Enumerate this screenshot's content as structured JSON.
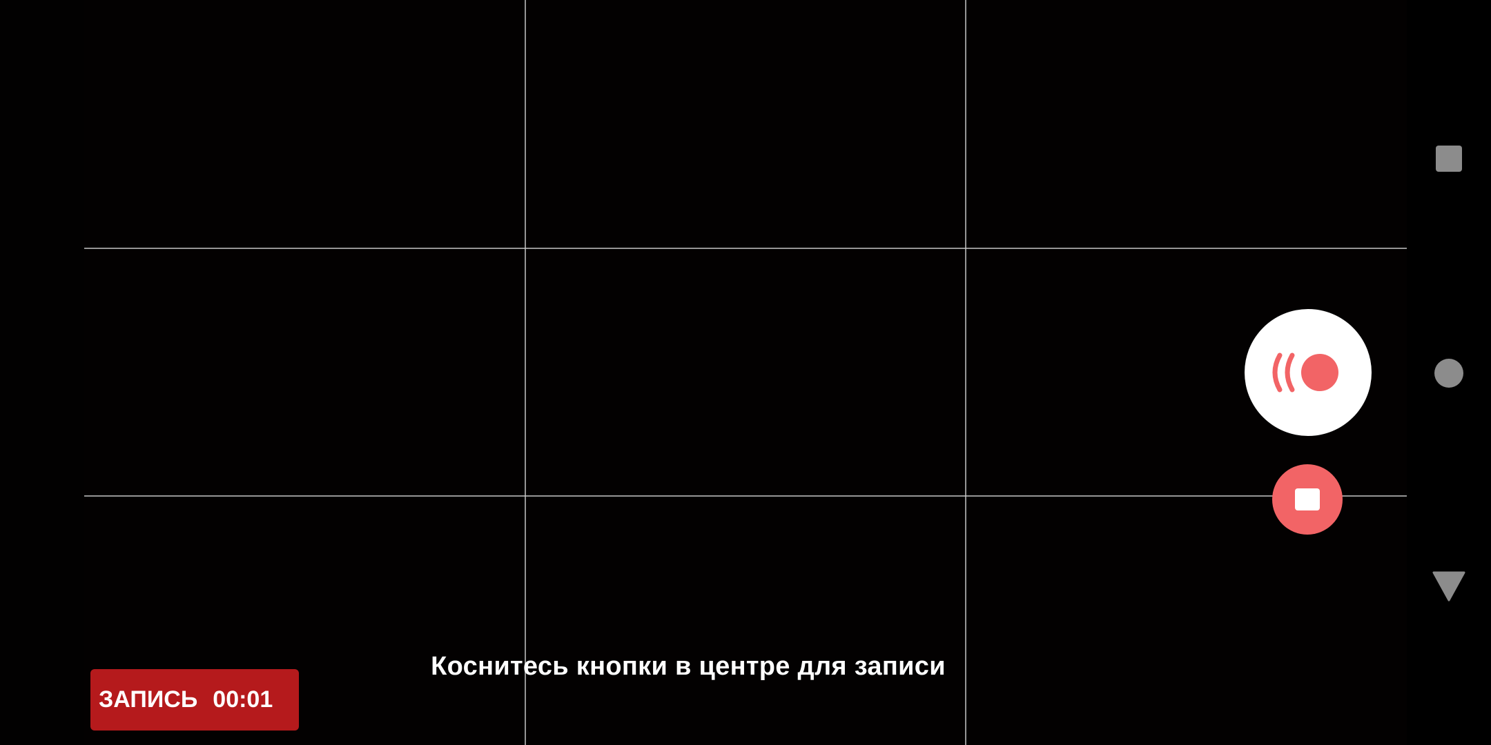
{
  "overlay": {
    "hint_text": "Коснитесь кнопки в центре для записи"
  },
  "recording": {
    "label": "ЗАПИСЬ",
    "elapsed": "00:01"
  },
  "controls": {
    "record_icon": "broadcast-record-icon",
    "stop_icon": "stop-icon"
  },
  "navbar": {
    "recent_icon": "recent-apps-icon",
    "home_icon": "home-icon",
    "back_icon": "back-icon"
  },
  "colors": {
    "accent_red": "#f26466",
    "badge_red": "#b51a1c",
    "background": "#000000",
    "grid": "#c8c8c8"
  }
}
